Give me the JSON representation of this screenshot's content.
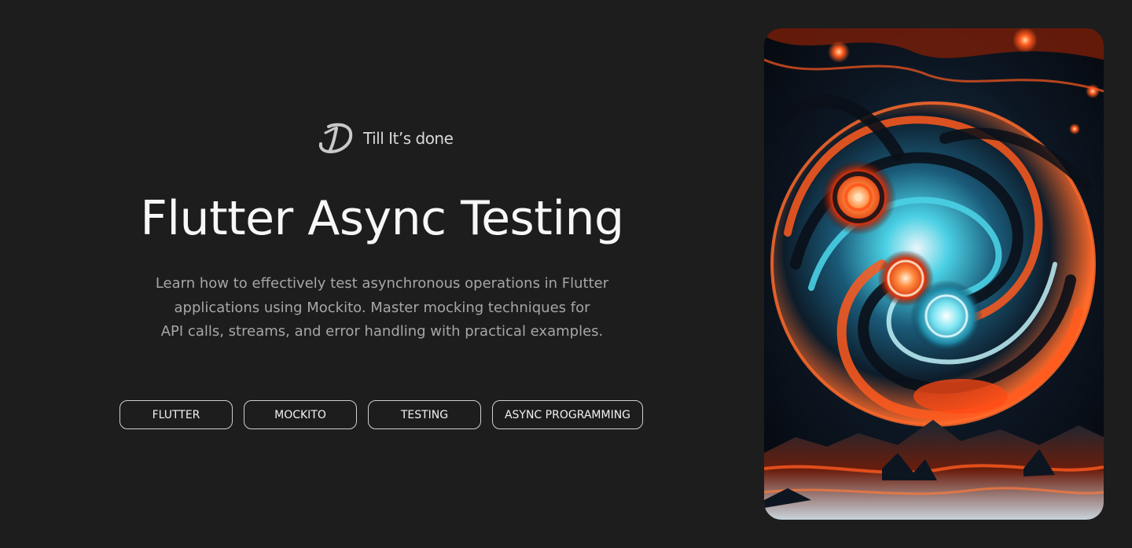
{
  "brand": {
    "logo_icon": "td-monogram-icon",
    "name": "Till It’s done"
  },
  "hero": {
    "title": "Flutter Async Testing",
    "description_lines": [
      "Learn how to effectively test asynchronous operations in Flutter",
      "applications using Mockito. Master mocking techniques for",
      "API calls, streams, and error handling with practical examples."
    ]
  },
  "tags": [
    {
      "label": "FLUTTER"
    },
    {
      "label": "MOCKITO"
    },
    {
      "label": "TESTING"
    },
    {
      "label": "ASYNC PROGRAMMING"
    }
  ],
  "colors": {
    "background": "#1d1d1d",
    "title": "#f7f7f7",
    "description": "#a6a6a6",
    "tag_border": "#cfcfcf",
    "art_orange": "#ff5a1f",
    "art_cyan": "#3fc8dc",
    "art_navy": "#0a0f18"
  }
}
